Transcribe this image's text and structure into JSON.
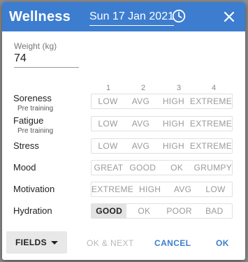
{
  "dialog": {
    "title": "Wellness",
    "date": "Sun 17 Jan 2021",
    "icons": {
      "clock": "clock-icon",
      "close": "close-icon"
    },
    "accent_color": "#3d7dcf"
  },
  "weight": {
    "label": "Weight (kg)",
    "value": "74"
  },
  "columns": [
    "1",
    "2",
    "3",
    "4"
  ],
  "rows": [
    {
      "label": "Soreness",
      "sub": "Pre training",
      "options": [
        "LOW",
        "AVG",
        "HIGH",
        "EXTREME"
      ],
      "selected": null
    },
    {
      "label": "Fatigue",
      "sub": "Pre training",
      "options": [
        "LOW",
        "AVG",
        "HIGH",
        "EXTREME"
      ],
      "selected": null
    },
    {
      "label": "Stress",
      "sub": "",
      "options": [
        "LOW",
        "AVG",
        "HIGH",
        "EXTREME"
      ],
      "selected": null
    },
    {
      "label": "Mood",
      "sub": "",
      "options": [
        "GREAT",
        "GOOD",
        "OK",
        "GRUMPY"
      ],
      "selected": null
    },
    {
      "label": "Motivation",
      "sub": "",
      "options": [
        "EXTREME",
        "HIGH",
        "AVG",
        "LOW"
      ],
      "selected": null
    },
    {
      "label": "Hydration",
      "sub": "",
      "options": [
        "GOOD",
        "OK",
        "POOR",
        "BAD"
      ],
      "selected": 0
    }
  ],
  "footer": {
    "fields": "FIELDS",
    "ok_next": "OK & NEXT",
    "cancel": "CANCEL",
    "ok": "OK"
  }
}
